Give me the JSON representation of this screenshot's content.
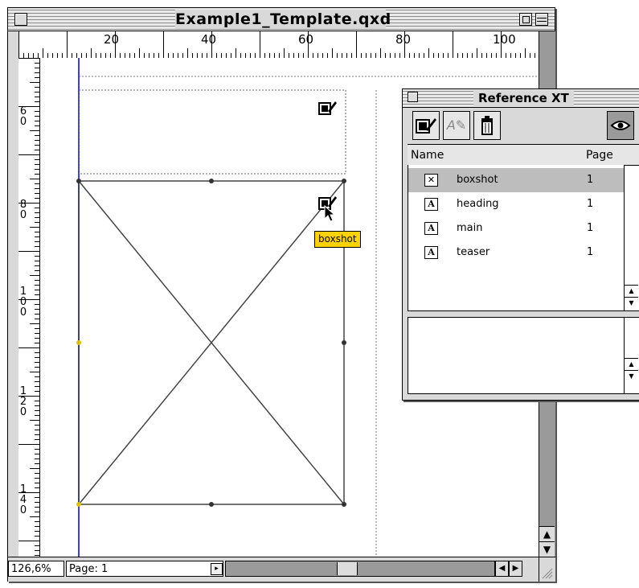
{
  "window": {
    "title": "Example1_Template.qxd",
    "zoom": "126,6%",
    "page_field": "Page: 1"
  },
  "ruler": {
    "horizontal_labels": [
      "20",
      "40",
      "60",
      "80",
      "100"
    ],
    "vertical_labels": [
      "60",
      "80",
      "100",
      "120",
      "140"
    ]
  },
  "tooltip": "boxshot",
  "palette": {
    "title": "Reference XT",
    "columns": {
      "name": "Name",
      "page": "Page"
    },
    "items": [
      {
        "icon": "picture-box-icon",
        "glyph": "✕",
        "name": "boxshot",
        "page": "1",
        "selected": true
      },
      {
        "icon": "text-box-icon",
        "glyph": "A",
        "name": "heading",
        "page": "1",
        "selected": false
      },
      {
        "icon": "text-box-icon",
        "glyph": "A",
        "name": "main",
        "page": "1",
        "selected": false
      },
      {
        "icon": "text-box-icon",
        "glyph": "A",
        "name": "teaser",
        "page": "1",
        "selected": false
      }
    ]
  },
  "colors": {
    "guide": "#3b3bff",
    "tooltip": "#ffd200",
    "selection": "#bdbdbd"
  }
}
